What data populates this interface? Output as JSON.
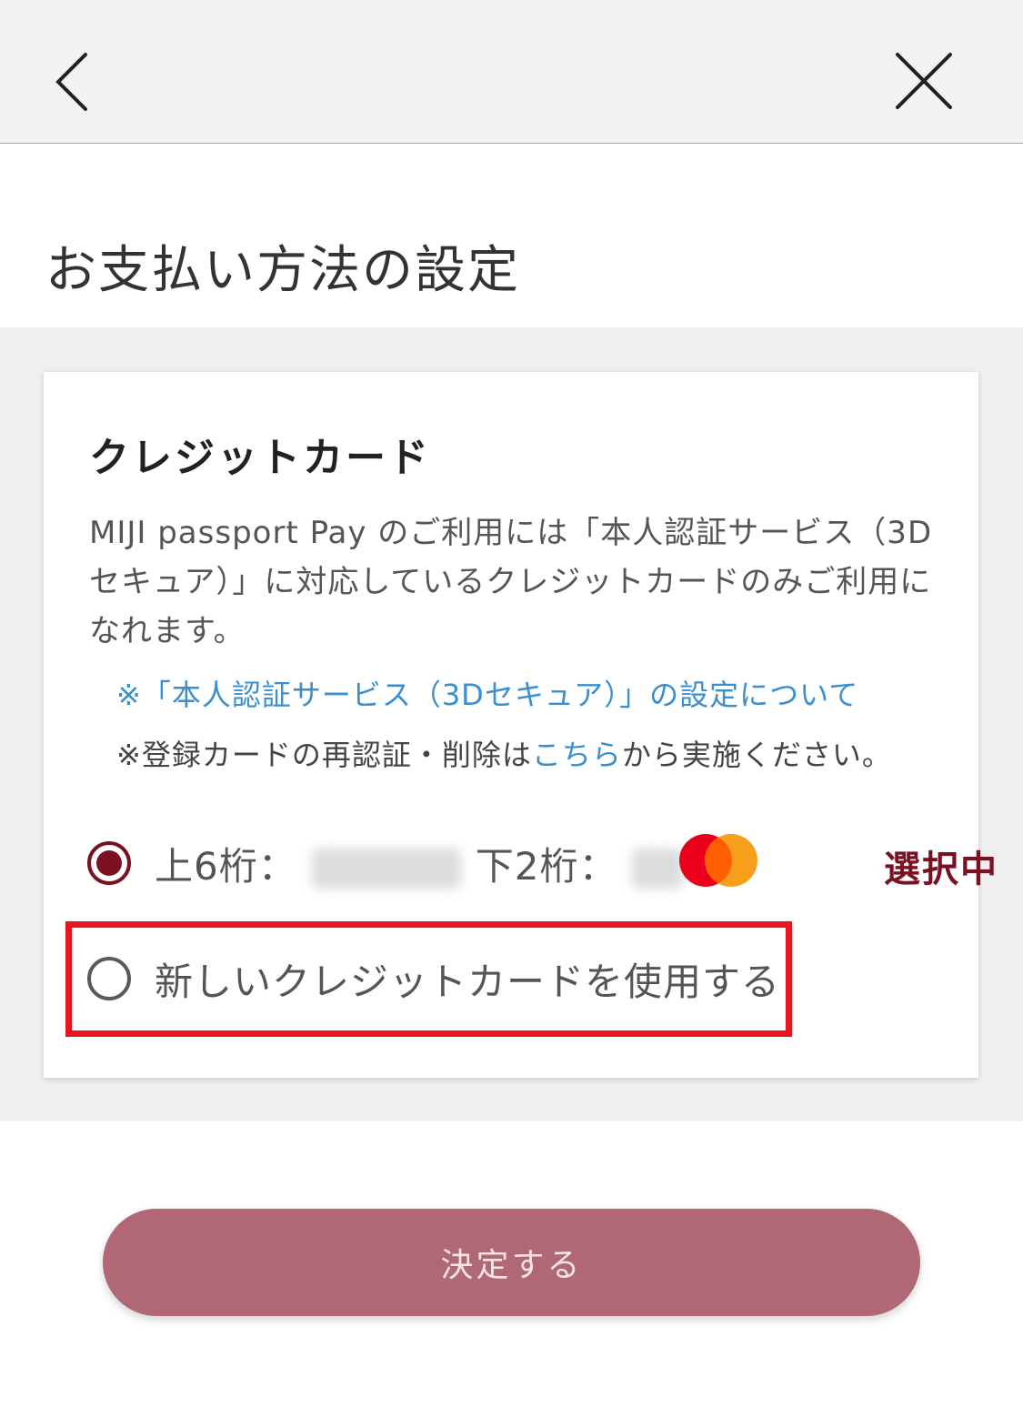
{
  "header": {
    "back_icon": "chevron-left-icon",
    "close_icon": "close-icon"
  },
  "page": {
    "title": "お支払い方法の設定"
  },
  "card": {
    "heading": "クレジットカード",
    "description": "MIJI passport Pay のご利用には「本人認証サービス（3Dセキュア）」に対応しているクレジットカードのみご利用になれます。",
    "link_3d_secure": "※「本人認証サービス（3Dセキュア）」の設定について",
    "note_prefix": "※登録カードの再認証・削除は",
    "note_link": "こちら",
    "note_suffix": "から実施ください。"
  },
  "options": {
    "saved_card": {
      "first6_label": "上6桁：",
      "last2_label": "下2桁：",
      "brand_icon": "mastercard-logo",
      "selected_label": "選択中",
      "checked": true
    },
    "new_card": {
      "label": "新しいクレジットカードを使用する",
      "checked": false
    }
  },
  "footer": {
    "submit_label": "決定する"
  },
  "colors": {
    "accent": "#7a1020",
    "button": "#b06875",
    "link": "#3a8fd0",
    "highlight": "#e8141e"
  }
}
